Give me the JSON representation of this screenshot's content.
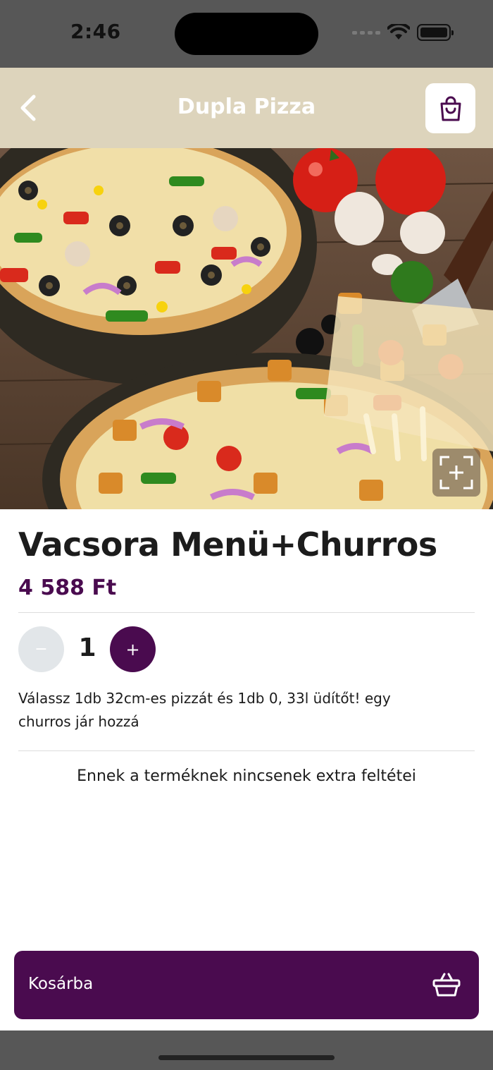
{
  "status_bar": {
    "time": "2:46",
    "icons": [
      "signal-dots-icon",
      "wifi-icon",
      "battery-icon"
    ]
  },
  "header": {
    "title": "Dupla Pizza",
    "back_icon": "chevron-left-icon",
    "cart_icon": "shopping-bag-icon",
    "background_color": "#ddd4bc"
  },
  "hero_image": {
    "description_icon": "pizza-photo",
    "zoom_icon": "expand-focus-icon"
  },
  "product": {
    "name": "Vacsora Menü+Churros",
    "price": "4 588 Ft",
    "quantity": "1",
    "minus_label": "−",
    "plus_label": "+",
    "description": "Válassz 1db 32cm-es pizzát és 1db 0, 33l üdítőt! egy churros jár hozzá",
    "extras_note": "Ennek a terméknek nincsenek extra feltétei"
  },
  "footer": {
    "add_to_cart_label": "Kosárba",
    "add_to_cart_icon": "basket-icon"
  },
  "colors": {
    "accent": "#4a0b4f",
    "minus_disabled": "#e2e6e9"
  }
}
